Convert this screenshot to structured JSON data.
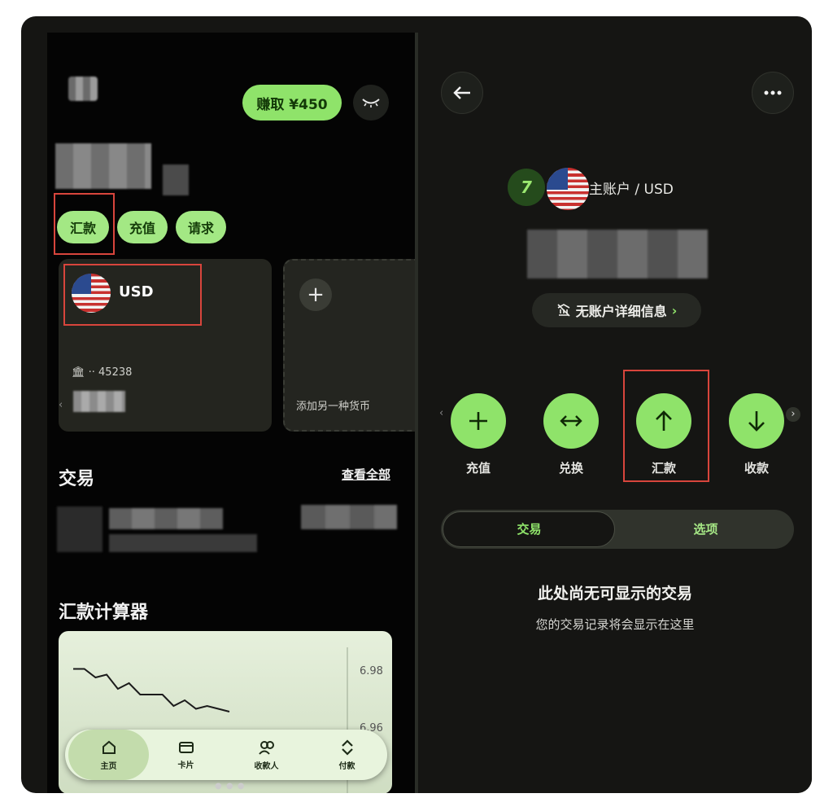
{
  "left": {
    "earn_button": "赚取 ¥450",
    "chips": [
      "汇款",
      "充值",
      "请求"
    ],
    "usd_card": {
      "currency": "USD",
      "bank_line": "🏛 ·· 45238"
    },
    "add_card": {
      "text": "添加另一种货币"
    },
    "transactions": {
      "title": "交易",
      "see_all": "查看全部"
    },
    "calculator": {
      "title": "汇款计算器",
      "rate_high": "6.98",
      "rate_low": "6.96",
      "series": [
        6.981,
        6.981,
        6.978,
        6.979,
        6.974,
        6.976,
        6.972,
        6.972,
        6.972,
        6.968,
        6.97,
        6.967,
        6.968,
        6.967,
        6.966
      ]
    },
    "tabbar": [
      {
        "label": "主页",
        "icon": "home-icon"
      },
      {
        "label": "卡片",
        "icon": "card-icon"
      },
      {
        "label": "收款人",
        "icon": "recipients-icon"
      },
      {
        "label": "付款",
        "icon": "payments-icon"
      }
    ]
  },
  "right": {
    "account_label": "主账户 / USD",
    "no_details": "无账户详细信息",
    "actions": [
      {
        "label": "充值",
        "icon": "plus-icon"
      },
      {
        "label": "兑换",
        "icon": "exchange-icon"
      },
      {
        "label": "汇款",
        "icon": "arrow-up-icon"
      },
      {
        "label": "收款",
        "icon": "arrow-down-icon"
      }
    ],
    "tabs": [
      "交易",
      "选项"
    ],
    "empty_title": "此处尚无可显示的交易",
    "empty_subtitle": "您的交易记录将会显示在这里"
  },
  "colors": {
    "accent": "#8fe36a",
    "highlight": "#d8453c",
    "dark": "#151513"
  }
}
